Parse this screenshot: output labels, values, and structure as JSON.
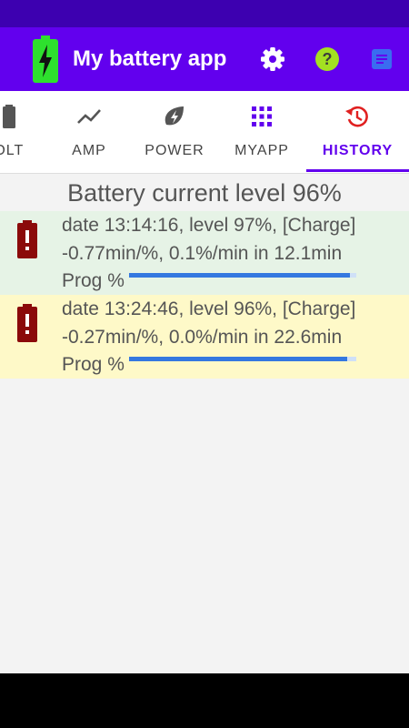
{
  "app_bar": {
    "title": "My battery app",
    "icons": [
      "battery-charging-logo",
      "settings-icon",
      "help-icon",
      "notes-icon"
    ],
    "colors": {
      "bar": "#6200ee",
      "status": "#3d00b0",
      "logo": "#2ee02e",
      "help": "#a3e021",
      "notes": "#3a6cf0"
    }
  },
  "tabs": [
    {
      "label": "VOLT",
      "icon": "battery-icon",
      "active": false
    },
    {
      "label": "AMP",
      "icon": "trend-line-icon",
      "active": false
    },
    {
      "label": "POWER",
      "icon": "eco-bolt-icon",
      "active": false
    },
    {
      "label": "MYAPP",
      "icon": "grid-icon",
      "active": false
    },
    {
      "label": "HISTORY",
      "icon": "history-icon",
      "active": true
    }
  ],
  "content": {
    "title": "Battery current level 96%",
    "entries": [
      {
        "line1": "date 13:14:16, level 97%, [Charge]",
        "line2": "-0.77min/%, 0.1%/min in 12.1min",
        "prog_label": "Prog %",
        "progress": 0.97,
        "bg": "#e6f3e6"
      },
      {
        "line1": "date 13:24:46, level 96%, [Charge]",
        "line2": "-0.27min/%, 0.0%/min in 22.6min",
        "prog_label": "Prog %",
        "progress": 0.96,
        "bg": "#fef9c8"
      }
    ]
  }
}
